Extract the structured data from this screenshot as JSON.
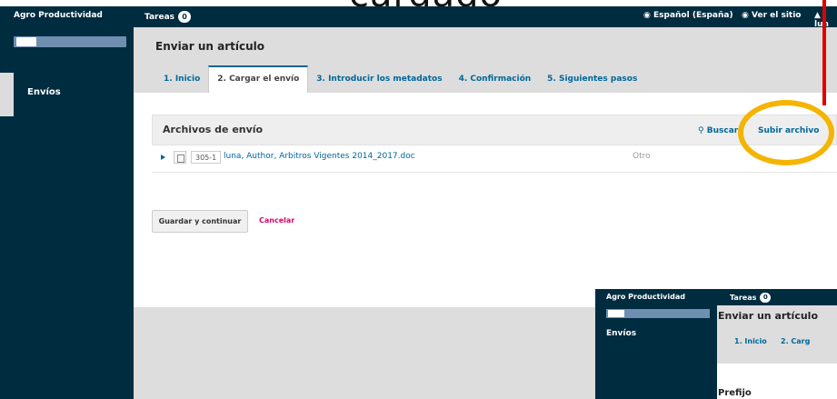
{
  "caption": "cargado",
  "topbar": {
    "site_name": "Agro Productividad",
    "tasks_label": "Tareas",
    "tasks_count": "0",
    "language": "Español (España)",
    "view_site": "Ver el sitio",
    "user": "lun"
  },
  "sidebar": {
    "item": "Envíos"
  },
  "page": {
    "title": "Enviar un artículo",
    "tabs": [
      {
        "label": "1. Inicio"
      },
      {
        "label": "2. Cargar el envío"
      },
      {
        "label": "3. Introducir los metadatos"
      },
      {
        "label": "4. Confirmación"
      },
      {
        "label": "5. Siguientes pasos"
      }
    ]
  },
  "files": {
    "title": "Archivos de envío",
    "search": "Buscar",
    "upload": "Subir archivo",
    "rows": [
      {
        "id": "305-1",
        "name": "luna, Author, Arbitros Vigentes 2014_2017.doc",
        "type": "Otro"
      }
    ]
  },
  "actions": {
    "save": "Guardar y continuar",
    "cancel": "Cancelar"
  },
  "inset": {
    "site_name": "Agro Productividad",
    "tasks_label": "Tareas",
    "tasks_count": "0",
    "title": "Enviar un artículo",
    "tab1": "1. Inicio",
    "tab2": "2. Carg",
    "sidebar_item": "Envíos",
    "prefix": "Prefijo"
  },
  "colors": {
    "nav": "#002c40",
    "link": "#006798",
    "highlight": "#f4b400",
    "cancel": "#d00a6c"
  }
}
